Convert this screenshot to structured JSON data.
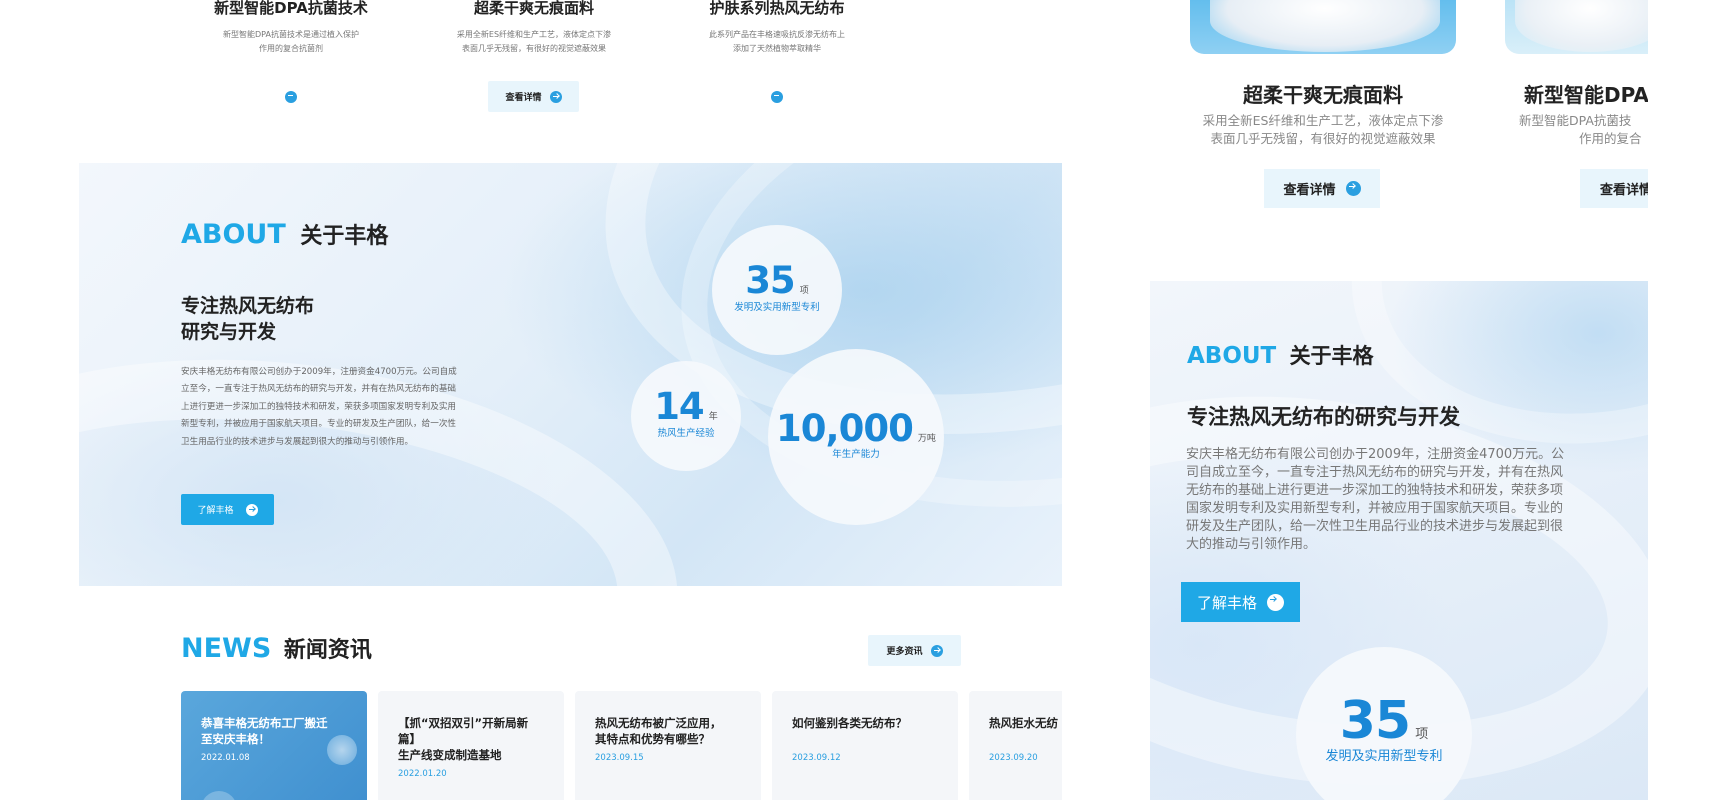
{
  "desktop": {
    "products": [
      {
        "title": "新型智能DPA抗菌技术",
        "desc_lines": [
          "新型智能DPA抗菌技术是通过植入保护",
          "作用的复合抗菌剂"
        ]
      },
      {
        "title": "超柔干爽无痕面料",
        "desc_lines": [
          "采用全新ES纤维和生产工艺，液体定点下渗",
          "表面几乎无残留，有很好的视觉遮蔽效果"
        ],
        "button": "查看详情"
      },
      {
        "title": "护肤系列热风无纺布",
        "desc_lines": [
          "此系列产品在丰格速吸抗反渗无纺布上",
          "添加了天然植物萃取精华"
        ]
      }
    ],
    "about": {
      "en": "ABOUT",
      "cn": "关于丰格",
      "heading_lines": [
        "专注热风无纺布",
        "研究与开发"
      ],
      "body_lines": [
        "安庆丰格无纺布有限公司创办于2009年，注册资金4700万元。公司自成",
        "立至今，一直专注于热风无纺布的研究与开发，并有在热风无纺布的基础",
        "上进行更进一步深加工的独特技术和研发，荣获多项国家发明专利及实用",
        "新型专利，并被应用于国家航天项目。专业的研发及生产团队，给一次性",
        "卫生用品行业的技术进步与发展起到很大的推动与引领作用。"
      ],
      "button": "了解丰格",
      "stats": [
        {
          "num": "35",
          "unit": "项",
          "label": "发明及实用新型专利"
        },
        {
          "num": "14",
          "unit": "年",
          "label": "热风生产经验"
        },
        {
          "num": "10,000",
          "unit": "万吨",
          "label": "年生产能力"
        }
      ]
    },
    "news": {
      "en": "NEWS",
      "cn": "新闻资讯",
      "more": "更多资讯",
      "items": [
        {
          "title_lines": [
            "恭喜丰格无纺布工厂搬迁",
            "至安庆丰格！"
          ],
          "date": "2022.01.08"
        },
        {
          "title_lines": [
            "【抓“双招双引”开新局新篇】",
            "生产线变成制造基地"
          ],
          "date": "2022.01.20"
        },
        {
          "title_lines": [
            "热风无纺布被广泛应用，",
            "其特点和优势有哪些？"
          ],
          "date": "2023.09.15"
        },
        {
          "title_lines": [
            "如何鉴别各类无纺布？",
            ""
          ],
          "date": "2023.09.12"
        },
        {
          "title_lines": [
            "热风拒水无纺",
            ""
          ],
          "date": "2023.09.20"
        }
      ]
    }
  },
  "mobile": {
    "products": [
      {
        "title": "超柔干爽无痕面料",
        "desc_lines": [
          "采用全新ES纤维和生产工艺，液体定点下渗",
          "表面几乎无残留，有很好的视觉遮蔽效果"
        ],
        "button": "查看详情"
      },
      {
        "title": "新型智能DPA",
        "desc_lines": [
          "新型智能DPA抗菌技",
          "作用的复合"
        ],
        "button": "查看详情"
      }
    ],
    "about": {
      "en": "ABOUT",
      "cn": "关于丰格",
      "heading": "专注热风无纺布的研究与开发",
      "body_lines": [
        "安庆丰格无纺布有限公司创办于2009年，注册资金4700万元。公",
        "司自成立至今，一直专注于热风无纺布的研究与开发，并有在热风",
        "无纺布的基础上进行更进一步深加工的独特技术和研发，荣获多项",
        "国家发明专利及实用新型专利，并被应用于国家航天项目。专业的",
        "研发及生产团队，给一次性卫生用品行业的技术进步与发展起到很",
        "大的推动与引领作用。"
      ],
      "button": "了解丰格",
      "stat": {
        "num": "35",
        "unit": "项",
        "label": "发明及实用新型专利"
      }
    }
  },
  "colors": {
    "accent": "#1fa8e6",
    "stat_blue": "#1a87d6",
    "light_btn": "#e8f5fc"
  }
}
